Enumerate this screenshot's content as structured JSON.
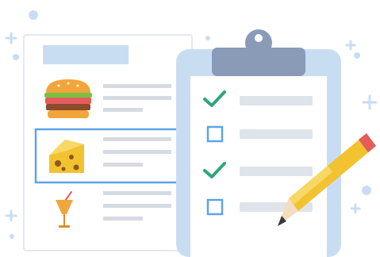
{
  "illustration": {
    "menu_card": {
      "items": [
        {
          "icon": "burger-icon"
        },
        {
          "icon": "cheese-icon",
          "selected": true
        },
        {
          "icon": "drink-icon"
        }
      ]
    },
    "clipboard": {
      "checklist": [
        {
          "icon": "check-icon",
          "checked": true
        },
        {
          "icon": "checkbox-icon",
          "checked": false
        },
        {
          "icon": "check-icon",
          "checked": true
        },
        {
          "icon": "checkbox-icon",
          "checked": false
        }
      ]
    },
    "pencil": {
      "icon": "pencil-icon"
    },
    "colors": {
      "light_blue": "#c9ddf2",
      "mid_blue": "#5ea3e8",
      "clip_gray": "#8a9bb8",
      "check_green": "#2ea77a",
      "line_gray": "#dfe3ea",
      "pencil_yellow": "#f2c230",
      "pencil_tip": "#e45c5c"
    }
  }
}
